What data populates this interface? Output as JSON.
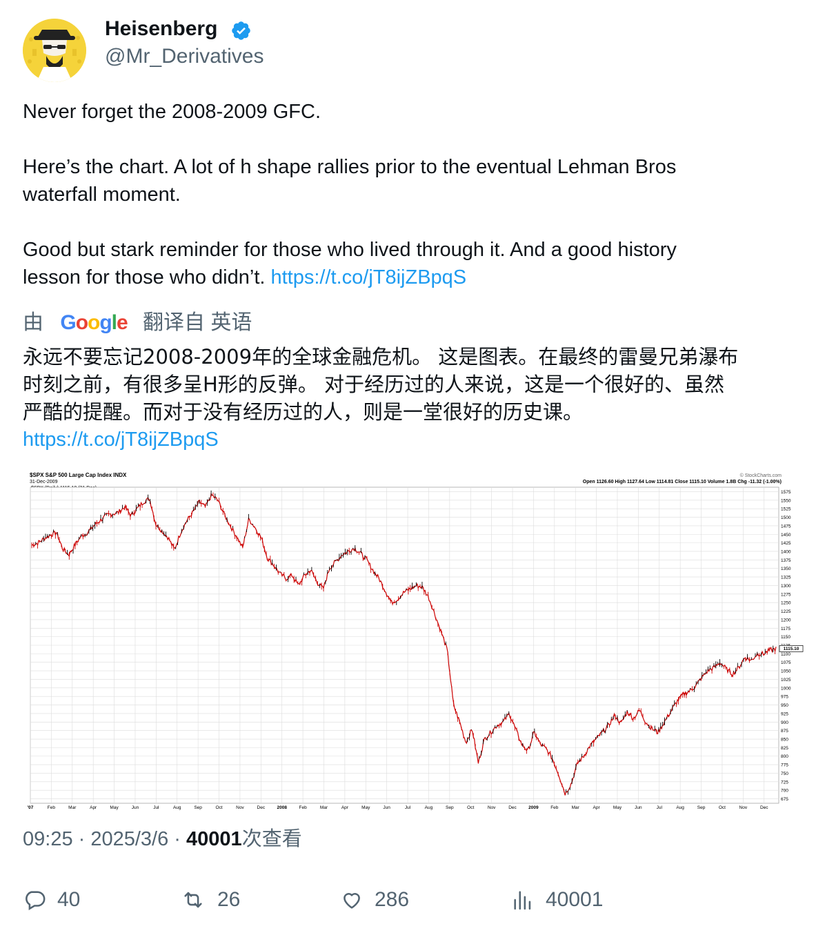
{
  "author": {
    "name": "Heisenberg",
    "handle": "@Mr_Derivatives",
    "verified": true,
    "avatar_icon": "heisenberg-avatar-icon"
  },
  "tweet": {
    "line1": "Never forget the 2008-2009 GFC.",
    "line2": "Here’s the chart. A lot of h shape rallies prior to the eventual Lehman Bros",
    "line3": "waterfall moment.",
    "line4": "Good but stark reminder for those who lived through it. And a good history",
    "line5_text": "lesson for those who didn’t. ",
    "link": "https://t.co/jT8ijZBpqS"
  },
  "translation": {
    "prefix": "由",
    "brand": "Google",
    "suffix": "翻译自 英语",
    "line1": "永远不要忘记2008-2009年的全球金融危机。 这是图表。在最终的雷曼兄弟瀑布",
    "line2": "时刻之前，有很多呈H形的反弹。 对于经历过的人来说，这是一个很好的、虽然",
    "line3": "严酷的提醒。而对于没有经历过的人，则是一堂很好的历史课。",
    "link": "https://t.co/jT8ijZBpqS"
  },
  "meta": {
    "time": "09:25",
    "date": "2025/3/6",
    "views": "40001",
    "views_label": "次查看"
  },
  "actions": {
    "replies": "40",
    "retweets": "26",
    "likes": "286",
    "views": "40001"
  },
  "colors": {
    "link": "#1d9bf0",
    "secondary": "#536471",
    "verified": "#1d9bf0",
    "candle_up": "#000000",
    "candle_down": "#cc0000"
  },
  "chart_data": {
    "type": "line",
    "title": "$SPX S&P 500 Large Cap Index INDX",
    "date": "31-Dec-2009",
    "legend": "$SPX (Daily) 1115.10 (31 Dec)",
    "watermark": "© StockCharts.com",
    "ohlc_summary": "Open 1126.60  High 1127.64  Low 1114.81  Close 1115.10  Volume 1.8B  Chg -11.32 (-1.00%)",
    "last_price_label": "1115.10",
    "x_labels": [
      "'07",
      "Feb",
      "Mar",
      "Apr",
      "May",
      "Jun",
      "Jul",
      "Aug",
      "Sep",
      "Oct",
      "Nov",
      "Dec",
      "2008",
      "Feb",
      "Mar",
      "Apr",
      "May",
      "Jun",
      "Jul",
      "Aug",
      "Sep",
      "Oct",
      "Nov",
      "Dec",
      "2009",
      "Feb",
      "Mar",
      "Apr",
      "May",
      "Jun",
      "Jul",
      "Aug",
      "Sep",
      "Oct",
      "Nov",
      "Dec"
    ],
    "y_ticks": [
      675,
      700,
      725,
      750,
      775,
      800,
      825,
      850,
      875,
      900,
      925,
      950,
      975,
      1000,
      1025,
      1050,
      1075,
      1100,
      1125,
      1150,
      1175,
      1200,
      1225,
      1250,
      1275,
      1300,
      1325,
      1350,
      1375,
      1400,
      1425,
      1450,
      1475,
      1500,
      1525,
      1550,
      1575
    ],
    "ylim": [
      662,
      1588
    ],
    "series": [
      {
        "values": [
          1418,
          1425,
          1438,
          1448,
          1455,
          1407,
          1390,
          1420,
          1445,
          1455,
          1475,
          1490,
          1505,
          1510,
          1515,
          1530,
          1505,
          1525,
          1545,
          1555,
          1480,
          1460,
          1440,
          1405,
          1455,
          1490,
          1515,
          1545,
          1530,
          1565,
          1550,
          1510,
          1475,
          1445,
          1410,
          1495,
          1470,
          1440,
          1380,
          1360,
          1335,
          1320,
          1330,
          1300,
          1330,
          1345,
          1310,
          1290,
          1350,
          1370,
          1390,
          1400,
          1410,
          1395,
          1375,
          1345,
          1320,
          1285,
          1250,
          1260,
          1280,
          1290,
          1300,
          1295,
          1265,
          1215,
          1165,
          1110,
          950,
          900,
          840,
          880,
          780,
          850,
          870,
          890,
          900,
          925,
          880,
          835,
          815,
          870,
          835,
          820,
          790,
          745,
          690,
          720,
          780,
          800,
          830,
          850,
          870,
          890,
          920,
          895,
          930,
          910,
          935,
          900,
          880,
          870,
          900,
          930,
          960,
          980,
          990,
          1005,
          1030,
          1050,
          1060,
          1075,
          1055,
          1040,
          1060,
          1090,
          1080,
          1100,
          1100,
          1110,
          1115
        ]
      }
    ]
  }
}
